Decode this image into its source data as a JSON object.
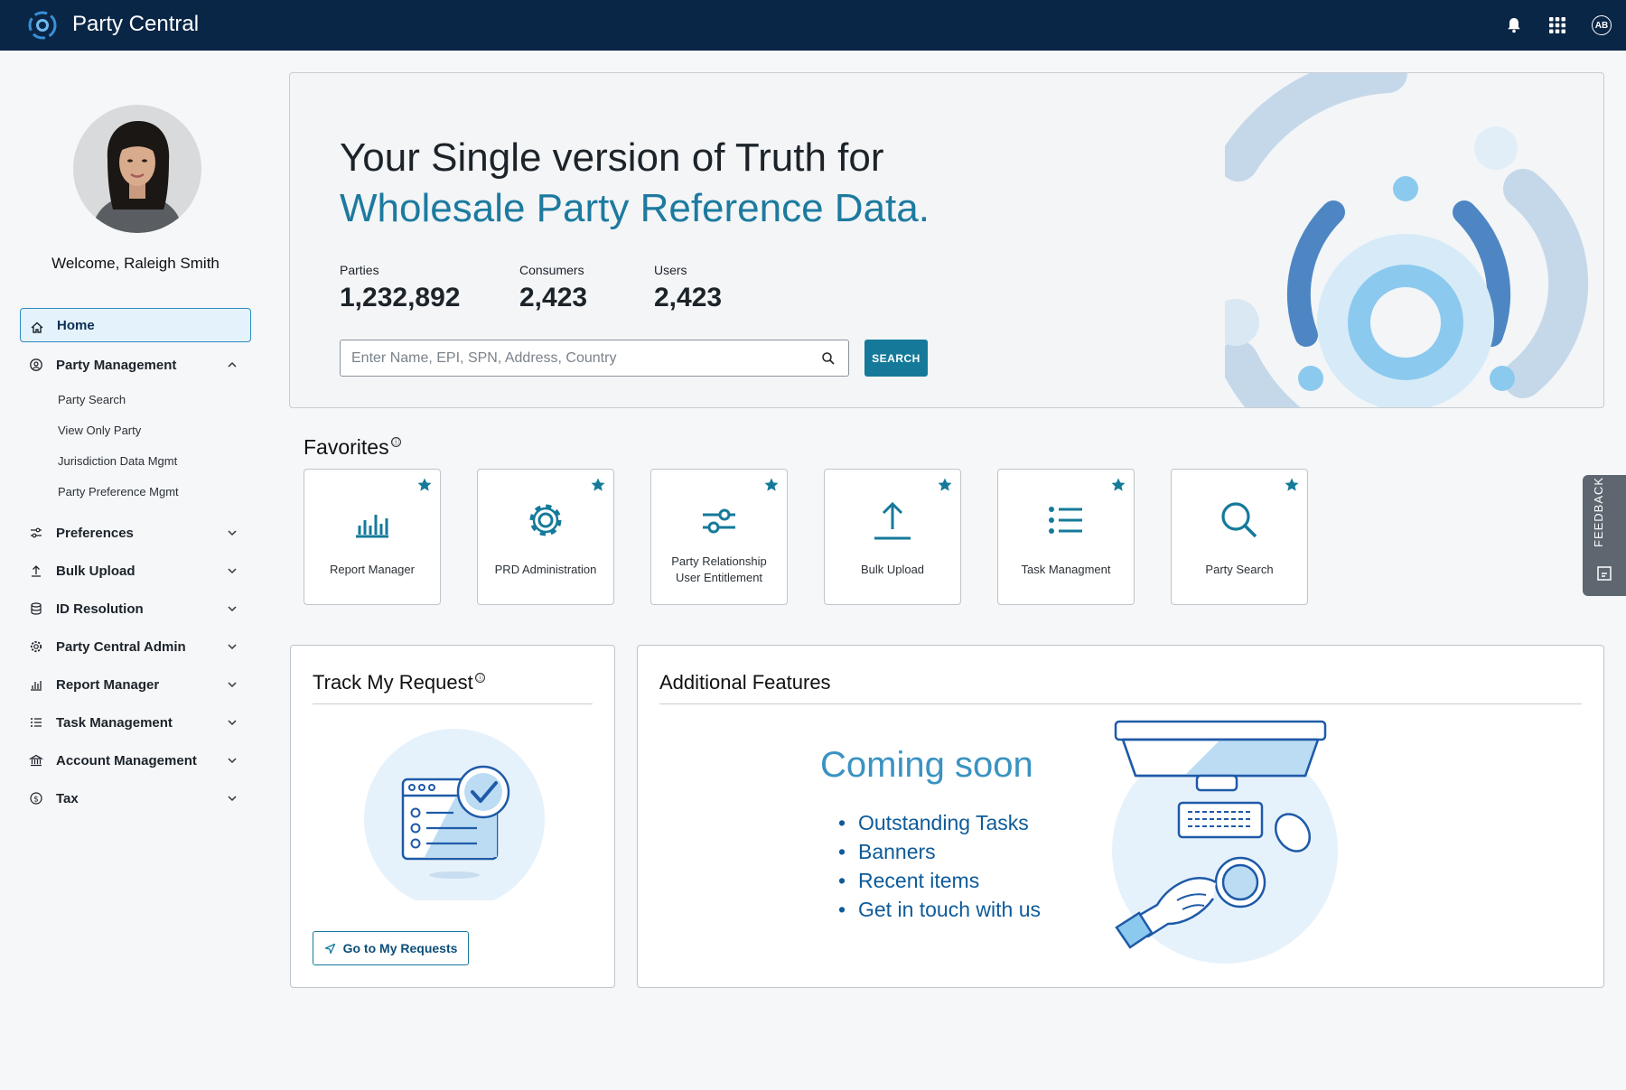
{
  "header": {
    "app_title": "Party Central",
    "icons": [
      "bell-icon",
      "app-grid-icon",
      "user-avatar"
    ],
    "avatar_initials": "AB",
    "bg_color": "#0a2646"
  },
  "sidebar": {
    "welcome": "Welcome, Raleigh Smith",
    "items": [
      {
        "label": "Home",
        "icon": "home-icon",
        "active": true
      },
      {
        "label": "Party Management",
        "icon": "party-management-icon",
        "expanded": true,
        "children": [
          "Party Search",
          "View Only Party",
          "Jurisdiction Data Mgmt",
          "Party Preference Mgmt"
        ]
      },
      {
        "label": "Preferences",
        "icon": "sliders-icon"
      },
      {
        "label": "Bulk Upload",
        "icon": "upload-icon"
      },
      {
        "label": "ID Resolution",
        "icon": "database-icon"
      },
      {
        "label": "Party Central Admin",
        "icon": "gear-icon"
      },
      {
        "label": "Report Manager",
        "icon": "bar-chart-icon"
      },
      {
        "label": "Task Management",
        "icon": "list-icon"
      },
      {
        "label": "Account Management",
        "icon": "bank-icon"
      },
      {
        "label": "Tax",
        "icon": "dollar-icon"
      }
    ]
  },
  "hero": {
    "line1": "Your Single version of Truth for",
    "line2": "Wholesale Party Reference Data.",
    "stats": [
      {
        "label": "Parties",
        "value": "1,232,892"
      },
      {
        "label": "Consumers",
        "value": "2,423"
      },
      {
        "label": "Users",
        "value": "2,423"
      }
    ],
    "search_placeholder": "Enter Name, EPI, SPN, Address, Country",
    "search_value": "",
    "search_button": "SEARCH"
  },
  "favorites": {
    "title": "Favorites",
    "info": "ⓘ",
    "cards": [
      {
        "label": "Report Manager",
        "icon": "bar-chart-icon"
      },
      {
        "label": "PRD Administration",
        "icon": "gear-icon"
      },
      {
        "label": "Party Relationship User Entitlement",
        "line1": "Party Relationship",
        "line2": "User Entitlement",
        "icon": "sliders-icon"
      },
      {
        "label": "Bulk Upload",
        "icon": "upload-icon"
      },
      {
        "label": "Task Managment",
        "icon": "list-icon"
      },
      {
        "label": "Party Search",
        "icon": "search-icon"
      }
    ]
  },
  "feedback": {
    "label": "FEEDBACK"
  },
  "track": {
    "title": "Track My Request",
    "info": "ⓘ",
    "button": "Go to My Requests"
  },
  "additional": {
    "title": "Additional Features",
    "coming_soon": "Coming soon",
    "features": [
      "Outstanding Tasks",
      "Banners",
      "Recent items",
      "Get in touch with us"
    ]
  },
  "colors": {
    "accent": "#157a9a",
    "hero_highlight": "#1d7a9f",
    "feature_text": "#0e5b9a"
  }
}
